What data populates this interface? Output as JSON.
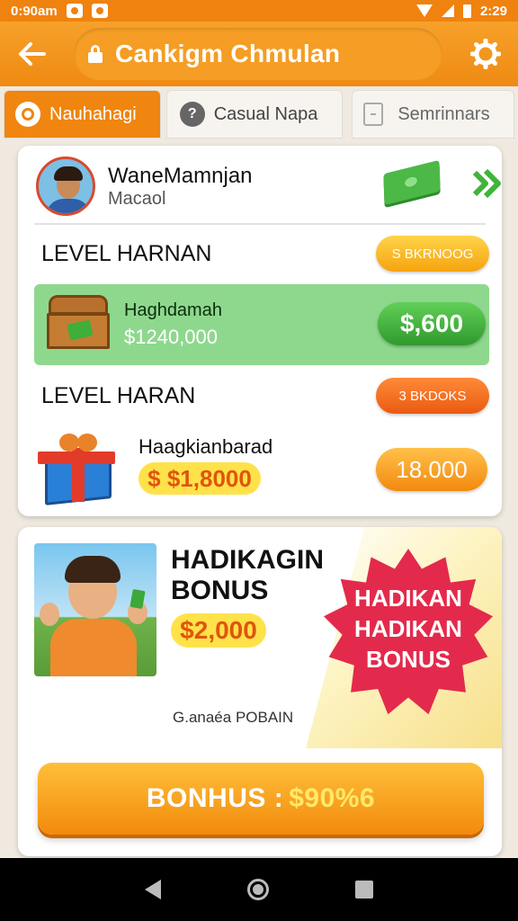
{
  "status_bar": {
    "time_left": "0:90am",
    "time_right": "2:29"
  },
  "app_bar": {
    "title": "Cankigm Chmulan"
  },
  "tabs": [
    {
      "label": "Nauhahagi"
    },
    {
      "label": "Casual Napa"
    },
    {
      "label": "Semrinnars"
    }
  ],
  "profile": {
    "name": "WaneMamnjan",
    "subtitle": "Macaol"
  },
  "levels": [
    {
      "title": "LEVEL HARNAN",
      "badge": "S BKRNOOG"
    },
    {
      "title": "LEVEL HARAN",
      "badge": "3 BKDOKS"
    }
  ],
  "reward_green": {
    "label": "Haghdamah",
    "sub": "$1240,000",
    "value": "$,600"
  },
  "reward_gift": {
    "label": "Haagkianbarad",
    "amount": "$ $1,8000",
    "value": "18.000"
  },
  "bonus": {
    "title": "HADIKAGIN BONUS",
    "amount": "$2,000",
    "burst_lines": [
      "HADIKAN",
      "HADIKAN",
      "BONUS"
    ],
    "footer": "G.anaéa POBAIN",
    "button_label": "BONHUS :",
    "button_value": "$90%6"
  },
  "colors": {
    "brand_orange": "#f0850f",
    "green": "#4cb846",
    "burst_red": "#e32a4c"
  },
  "icons": [
    "back-arrow-icon",
    "lock-icon",
    "settings-gear-icon",
    "chat-bubble-icon",
    "help-icon",
    "document-icon",
    "cash-icon",
    "chevron-right-icon",
    "treasure-chest-icon",
    "gift-box-icon"
  ]
}
